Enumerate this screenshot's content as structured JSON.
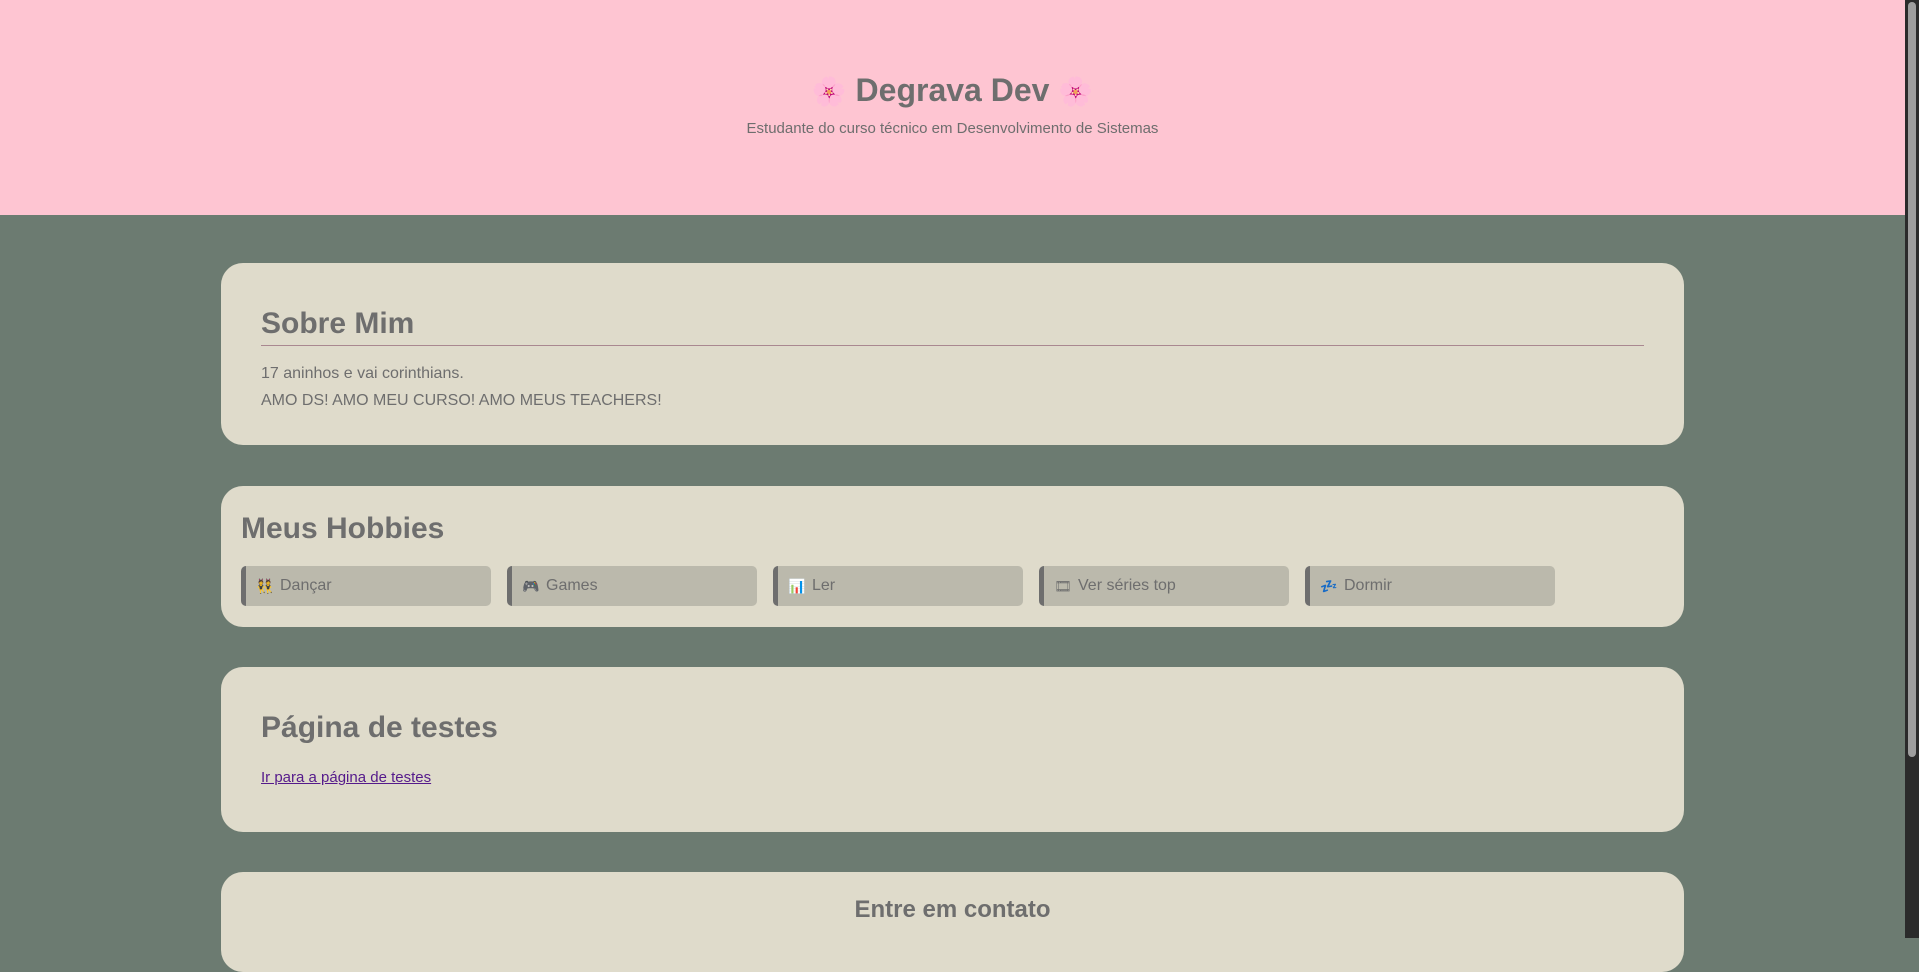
{
  "header": {
    "flower_icon": "🌸",
    "title": "Degrava Dev",
    "subtitle": "Estudante do curso técnico em Desenvolvimento de Sistemas"
  },
  "about": {
    "title": "Sobre Mim",
    "line1": "17 aninhos e vai corinthians.",
    "line2": "AMO DS! AMO MEU CURSO! AMO MEUS TEACHERS!"
  },
  "hobbies": {
    "title": "Meus Hobbies",
    "items": [
      {
        "icon": "👯",
        "icon_name": "dancers-icon",
        "label": "Dançar"
      },
      {
        "icon": "🎮",
        "icon_name": "gamepad-icon",
        "label": "Games"
      },
      {
        "icon": "📊",
        "icon_name": "books-icon",
        "label": "Ler"
      },
      {
        "icon": "🎞",
        "icon_name": "film-icon",
        "label": "Ver séries top"
      },
      {
        "icon": "💤",
        "icon_name": "sleep-icon",
        "label": "Dormir"
      }
    ]
  },
  "tests": {
    "title": "Página de testes",
    "link_label": "Ir para a página de testes"
  },
  "contact": {
    "title": "Entre em contato"
  },
  "colors": {
    "header_bg": "#fec5d2",
    "page_bg": "#6c7b71",
    "card_bg": "#dfdbcb",
    "hobby_bg": "#bbb9ac",
    "text": "#6e6e6e",
    "link": "#551a8b"
  }
}
